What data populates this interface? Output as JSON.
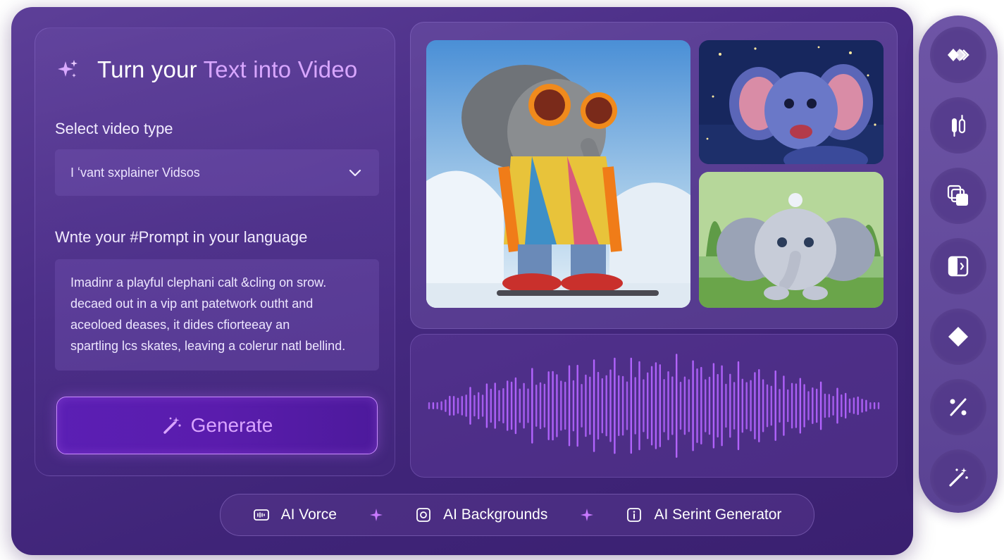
{
  "header": {
    "title_plain": "Turn your",
    "title_accent": "Text into Video"
  },
  "video_type": {
    "label": "Select video type",
    "selected": "I ʻvant sxplainer Vidsos"
  },
  "prompt": {
    "label": "Wnte your #Prompt in your language",
    "lines": [
      "Imadinr a playful clephani calt &cling on srow.",
      "decaed out in a vip ant patetwork outht and",
      "aceoloed deases, it dides cfiorteeay an",
      "spartling lcs skates, leaving a colerur natl bellind."
    ]
  },
  "generate": {
    "label": "Generate"
  },
  "gallery": {
    "images": [
      {
        "icon": "elephant-sunglasses-skates-image"
      },
      {
        "icon": "elephant-night-sky-image"
      },
      {
        "icon": "elephant-garden-image"
      }
    ]
  },
  "waveform": {
    "icon": "audio-waveform",
    "color": "#b464ff"
  },
  "features": [
    {
      "label": "AI Vorce",
      "icon": "voice-icon"
    },
    {
      "label": "AI Backgrounds",
      "icon": "background-icon"
    },
    {
      "label": "AI Serint Generator",
      "icon": "info-icon"
    }
  ],
  "toolbar": {
    "tools": [
      {
        "icon": "fast-forward-icon"
      },
      {
        "icon": "adjust-icon"
      },
      {
        "icon": "layers-icon"
      },
      {
        "icon": "split-panel-icon"
      },
      {
        "icon": "diamond-icon"
      },
      {
        "icon": "percent-icon"
      },
      {
        "icon": "magic-wand-icon"
      }
    ]
  },
  "colors": {
    "accent": "#d8a6ff",
    "button_bg": "#5a1cad",
    "card_bg": "#4a2d86"
  }
}
